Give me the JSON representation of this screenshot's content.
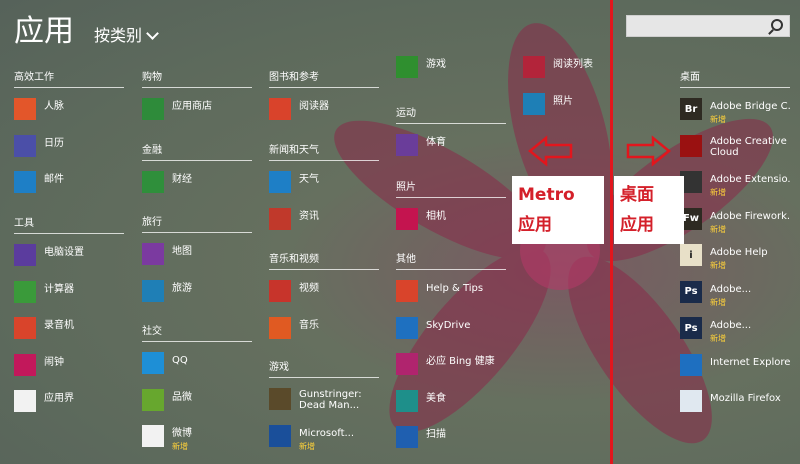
{
  "header": {
    "title": "应用",
    "sort_label": "按类别"
  },
  "search": {
    "placeholder": ""
  },
  "columns": [
    {
      "groups": [
        {
          "name": "高效工作",
          "items": [
            {
              "label": "人脉",
              "icon": "people-icon",
              "color": "#e3562a"
            },
            {
              "label": "日历",
              "icon": "calendar-icon",
              "color": "#4b4fa8"
            },
            {
              "label": "邮件",
              "icon": "mail-icon",
              "color": "#1e7fc6"
            }
          ]
        },
        {
          "name": "工具",
          "items": [
            {
              "label": "电脑设置",
              "icon": "gear-icon",
              "color": "#5b3c9e"
            },
            {
              "label": "计算器",
              "icon": "calculator-icon",
              "color": "#3a9a3a"
            },
            {
              "label": "录音机",
              "icon": "microphone-icon",
              "color": "#d9442b"
            },
            {
              "label": "闹钟",
              "icon": "alarm-icon",
              "color": "#c2185b"
            },
            {
              "label": "应用界",
              "icon": "app-world-icon",
              "color": "#f2f2f2"
            }
          ]
        }
      ]
    },
    {
      "groups": [
        {
          "name": "购物",
          "items": [
            {
              "label": "应用商店",
              "icon": "store-icon",
              "color": "#2e8b3a"
            }
          ]
        },
        {
          "name": "金融",
          "items": [
            {
              "label": "财经",
              "icon": "finance-icon",
              "color": "#2f8f3b"
            }
          ]
        },
        {
          "name": "旅行",
          "items": [
            {
              "label": "地图",
              "icon": "map-icon",
              "color": "#7b3aa0"
            },
            {
              "label": "旅游",
              "icon": "travel-icon",
              "color": "#1f7fb6"
            }
          ]
        },
        {
          "name": "社交",
          "items": [
            {
              "label": "QQ",
              "icon": "qq-icon",
              "color": "#1e8fd6"
            },
            {
              "label": "品微",
              "icon": "pinwei-icon",
              "color": "#67a72e"
            },
            {
              "label": "微博",
              "icon": "weibo-icon",
              "color": "#f2f2f2",
              "new": "新增"
            }
          ]
        }
      ]
    },
    {
      "groups": [
        {
          "name": "图书和参考",
          "items": [
            {
              "label": "阅读器",
              "icon": "reader-icon",
              "color": "#d9432b"
            }
          ]
        },
        {
          "name": "新闻和天气",
          "items": [
            {
              "label": "天气",
              "icon": "weather-icon",
              "color": "#1e7fc6"
            },
            {
              "label": "资讯",
              "icon": "news-icon",
              "color": "#c0392b"
            }
          ]
        },
        {
          "name": "音乐和视频",
          "items": [
            {
              "label": "视频",
              "icon": "video-icon",
              "color": "#c7342b"
            },
            {
              "label": "音乐",
              "icon": "music-icon",
              "color": "#e05a22"
            }
          ]
        },
        {
          "name": "游戏",
          "items": [
            {
              "label": "Gunstringer: Dead Man...",
              "icon": "gunstringer-icon",
              "color": "#5a4a2a",
              "two": true
            },
            {
              "label": "Microsoft...",
              "icon": "solitaire-icon",
              "color": "#1a4f9a",
              "new": "新增"
            }
          ]
        }
      ]
    },
    {
      "groups": [
        {
          "name": "",
          "items": [
            {
              "label": "游戏",
              "icon": "xbox-icon",
              "color": "#2f8f2f"
            }
          ]
        },
        {
          "name": "运动",
          "items": [
            {
              "label": "体育",
              "icon": "trophy-icon",
              "color": "#6a3d9a"
            }
          ]
        },
        {
          "name": "照片",
          "items": [
            {
              "label": "相机",
              "icon": "camera-icon",
              "color": "#c4144f"
            }
          ]
        },
        {
          "name": "其他",
          "items": [
            {
              "label": "Help & Tips",
              "icon": "help-icon",
              "color": "#d9442b"
            },
            {
              "label": "SkyDrive",
              "icon": "cloud-icon",
              "color": "#1e70c0"
            },
            {
              "label": "必应 Bing 健康",
              "icon": "health-icon",
              "color": "#b0246e"
            },
            {
              "label": "美食",
              "icon": "food-icon",
              "color": "#1e8f8a"
            },
            {
              "label": "扫描",
              "icon": "scan-icon",
              "color": "#1f5fb0"
            }
          ]
        }
      ]
    },
    {
      "groups": [
        {
          "name": "",
          "items": [
            {
              "label": "阅读列表",
              "icon": "reading-list-icon",
              "color": "#b3243a"
            },
            {
              "label": "照片",
              "icon": "photos-icon",
              "color": "#1e7fb6"
            }
          ]
        }
      ]
    },
    {
      "groups": [
        {
          "name": "桌面",
          "items": [
            {
              "label": "Adobe Bridge C...",
              "icon": "br-icon",
              "color": "#2e2a22",
              "new": "新增",
              "badge": "Br"
            },
            {
              "label": "Adobe Creative Cloud",
              "icon": "creative-cloud-icon",
              "color": "#9a1111",
              "two": true
            },
            {
              "label": "Adobe Extensio...",
              "icon": "extension-icon",
              "color": "#333333",
              "new": "新增"
            },
            {
              "label": "Adobe Firework...",
              "icon": "fw-icon",
              "color": "#2e2a22",
              "new": "新增",
              "badge": "Fw"
            },
            {
              "label": "Adobe Help",
              "icon": "info-icon",
              "color": "#e8e0c8",
              "new": "新增",
              "badge": "i"
            },
            {
              "label": "Adobe...",
              "icon": "ps-icon",
              "color": "#1a2b4a",
              "new": "新增",
              "badge": "Ps"
            },
            {
              "label": "Adobe...",
              "icon": "ps-icon",
              "color": "#1a2b4a",
              "new": "新增",
              "badge": "Ps"
            },
            {
              "label": "Internet Explorer",
              "icon": "ie-icon",
              "color": "#1e6fc0"
            },
            {
              "label": "Mozilla Firefox",
              "icon": "firefox-icon",
              "color": "#e0e8f0"
            }
          ]
        }
      ]
    }
  ],
  "annotations": {
    "metro_label": [
      "Metro",
      "应用"
    ],
    "desktop_label": [
      "桌面",
      "应用"
    ],
    "line_color": "#e2161d"
  }
}
